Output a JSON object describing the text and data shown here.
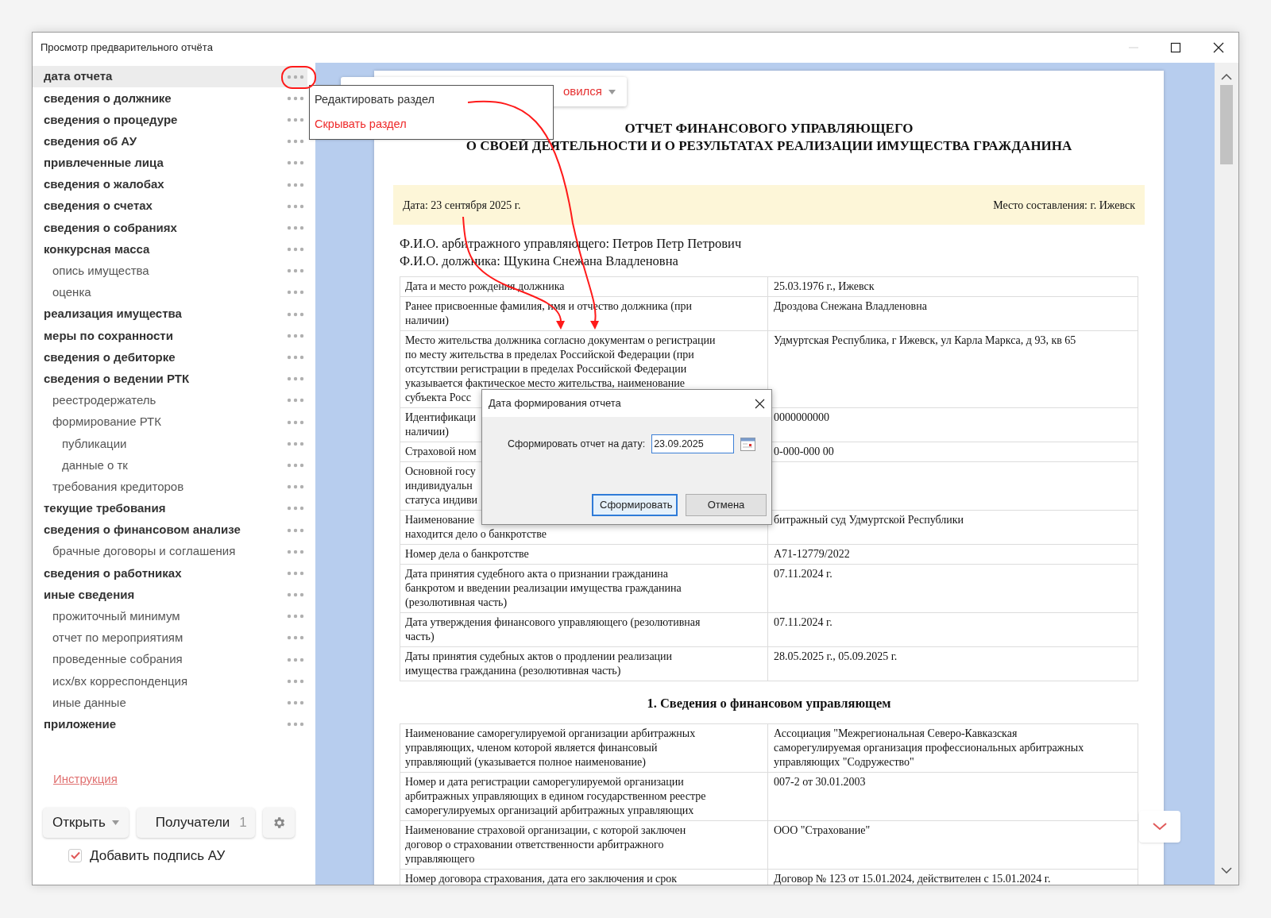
{
  "window": {
    "title": "Просмотр предварительного отчёта"
  },
  "sidebar": {
    "items": [
      {
        "label": "дата отчета",
        "selected": true
      },
      {
        "label": "сведения о должнике",
        "selected": false
      },
      {
        "label": "сведения о процедуре",
        "selected": false
      },
      {
        "label": "сведения об АУ",
        "selected": false
      },
      {
        "label": "привлеченные лица",
        "selected": false
      },
      {
        "label": "сведения о жалобах",
        "selected": false
      },
      {
        "label": "сведения о счетах",
        "selected": false
      },
      {
        "label": "сведения о собраниях",
        "selected": false
      },
      {
        "label": "конкурсная масса",
        "selected": false,
        "children": [
          {
            "label": "опись имущества",
            "selected": false
          },
          {
            "label": "оценка",
            "selected": false
          }
        ]
      },
      {
        "label": "реализация имущества",
        "selected": false
      },
      {
        "label": "меры по сохранности",
        "selected": false
      },
      {
        "label": "сведения о дебиторке",
        "selected": false
      },
      {
        "label": "сведения о ведении РТК",
        "selected": false,
        "children": [
          {
            "label": "реестродержатель",
            "selected": false
          },
          {
            "label": "формирование РТК",
            "selected": false,
            "children": [
              {
                "label": "публикации",
                "selected": false
              },
              {
                "label": "данные о тк",
                "selected": false
              }
            ]
          },
          {
            "label": "требования кредиторов",
            "selected": false
          }
        ]
      },
      {
        "label": "текущие требования",
        "selected": false
      },
      {
        "label": "сведения о финансовом анализе",
        "selected": false,
        "children": [
          {
            "label": "брачные договоры и соглашения",
            "selected": false
          }
        ]
      },
      {
        "label": "сведения о работниках",
        "selected": false
      },
      {
        "label": "иные сведения",
        "selected": false,
        "children": [
          {
            "label": "прожиточный минимум",
            "selected": false
          },
          {
            "label": "отчет по мероприятиям",
            "selected": false
          },
          {
            "label": "проведенные собрания",
            "selected": false
          },
          {
            "label": "исх/вх корреспонденция",
            "selected": false
          },
          {
            "label": "иные данные",
            "selected": false
          }
        ]
      },
      {
        "label": "приложение",
        "selected": false
      }
    ],
    "instruction_link": "Инструкция",
    "open_button": "Открыть",
    "recipients_button": {
      "label": "Получатели",
      "count": "1"
    },
    "sign_checkbox": {
      "label": "Добавить подпись АУ",
      "checked": true
    }
  },
  "status_dropdown": {
    "label": "овился"
  },
  "context_menu": {
    "items": [
      {
        "label": "Редактировать раздел",
        "kind": "normal"
      },
      {
        "label": "Скрывать раздел",
        "kind": "danger"
      }
    ]
  },
  "document": {
    "title_lines": [
      "ОТЧЕТ ФИНАНСОВОГО УПРАВЛЯЮЩЕГО",
      "О СВОЕЙ ДЕЯТЕЛЬНОСТИ И О РЕЗУЛЬТАТАХ РЕАЛИЗАЦИИ ИМУЩЕСТВА ГРАЖДАНИНА"
    ],
    "date": "Дата: 23 сентября 2025 г.",
    "place": "Место составления: г. Ижевск",
    "fio_lines": [
      "Ф.И.О. арбитражного управляющего: Петров Петр Петрович",
      "Ф.И.О. должника: Щукина Снежана Владленовна"
    ],
    "table_rows": [
      {
        "label": "Дата и место рождения должника",
        "value": "25.03.1976 г., Ижевск"
      },
      {
        "label": "Ранее присвоенные фамилия, имя и отчество должника (при\nналичии)",
        "value": "Дроздова Снежана Владленовна"
      },
      {
        "label": "Место жительства должника согласно документам о регистрации\nпо месту жительства в пределах Российской Федерации (при\nотсутствии регистрации в пределах Российской Федерации\nуказывается фактическое место жительства, наименование\nсубъекта Росс",
        "value": "Удмуртская Республика, г Ижевск, ул Карла Маркса, д 93, кв 65"
      },
      {
        "label": "Идентификаци\nналичии)",
        "value": "0000000000"
      },
      {
        "label": "Страховой ном",
        "value": "0-000-000 00"
      },
      {
        "label": "Основной госу\nиндивидуальн\nстатуса индиви"
      },
      {
        "label": "Наименование\nнаходится дело о банкротстве",
        "value": "битражный суд Удмуртской Республики"
      },
      {
        "label": "Номер дела о банкротстве",
        "value": "А71-12779/2022"
      },
      {
        "label": "Дата принятия судебного акта о признании гражданина\nбанкротом и введении реализации имущества гражданина\n(резолютивная часть)",
        "value": "07.11.2024 г."
      },
      {
        "label": "Дата утверждения финансового управляющего (резолютивная\nчасть)",
        "value": "07.11.2024 г."
      },
      {
        "label": "Даты принятия судебных актов о продлении реализации\nимущества гражданина (резолютивная часть)",
        "value": "28.05.2025 г., 05.09.2025 г."
      }
    ],
    "section_1": {
      "heading": "1. Сведения о финансовом управляющем",
      "rows": [
        {
          "label": "Наименование саморегулируемой организации арбитражных\nуправляющих, членом которой является финансовый\nуправляющий (указывается полное наименование)",
          "value": "Ассоциация \"Межрегиональная Северо-Кавказская\nсаморегулируемая организация профессиональных арбитражных\nуправляющих \"Содружество\""
        },
        {
          "label": "Номер и дата регистрации саморегулируемой организации\nарбитражных управляющих в едином государственном реестре\nсаморегулируемых организаций арбитражных управляющих",
          "value": "007-2 от 30.01.2003"
        },
        {
          "label": "Наименование страховой организации, с которой заключен\nдоговор о страховании ответственности арбитражного\nуправляющего",
          "value": "ООО \"Страхование\""
        },
        {
          "label": "Номер договора страхования, дата его заключения и срок",
          "value": "Договор № 123 от 15.01.2024, действителен с 15.01.2024 г."
        }
      ]
    }
  },
  "dialog": {
    "title": "Дата формирования отчета",
    "label": "Сформировать отчет на дату:",
    "date_value": "23.09.2025",
    "buttons": [
      {
        "label": "Сформировать",
        "kind": "primary"
      },
      {
        "label": "Отмена",
        "kind": "secondary"
      }
    ]
  }
}
